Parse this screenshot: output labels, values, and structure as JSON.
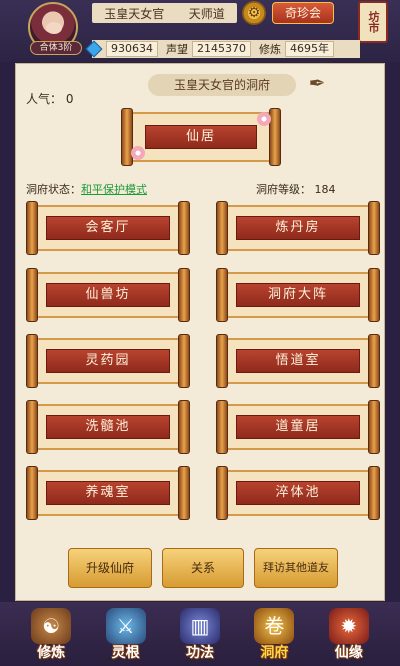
{
  "header": {
    "avatar_realm": "合体3阶",
    "player_name": "玉皇天女官",
    "sect": "天师道",
    "treasure_button": "奇珍会",
    "market_sign": "坊市",
    "stones": "930634",
    "reputation_label": "声望",
    "reputation": "2145370",
    "cultivation_label": "修炼",
    "cultivation": "4695年"
  },
  "panel": {
    "title": "玉皇天女官的洞府",
    "popularity": "人气：  0",
    "main_hall": "仙居",
    "status_label": "洞府状态：",
    "status_mode": "和平保护模式",
    "level_label": "洞府等级：",
    "level": "184",
    "rooms": [
      "会客厅",
      "炼丹房",
      "仙兽坊",
      "洞府大阵",
      "灵药园",
      "悟道室",
      "洗髓池",
      "道童居",
      "养魂室",
      "淬体池"
    ],
    "buttons": {
      "upgrade": "升级仙府",
      "relations": "关系",
      "visit": "拜访其他道友"
    }
  },
  "nav": [
    {
      "label": "修炼",
      "icon": "monk-icon"
    },
    {
      "label": "灵根",
      "icon": "sword-icon"
    },
    {
      "label": "功法",
      "icon": "book-icon"
    },
    {
      "label": "洞府",
      "icon": "scroll-icon"
    },
    {
      "label": "仙缘",
      "icon": "fire-icon"
    }
  ],
  "colors": {
    "scroll_band": "#b8432f",
    "status_mode": "#1f9a3a",
    "active_nav_label": "#ffd54a"
  }
}
